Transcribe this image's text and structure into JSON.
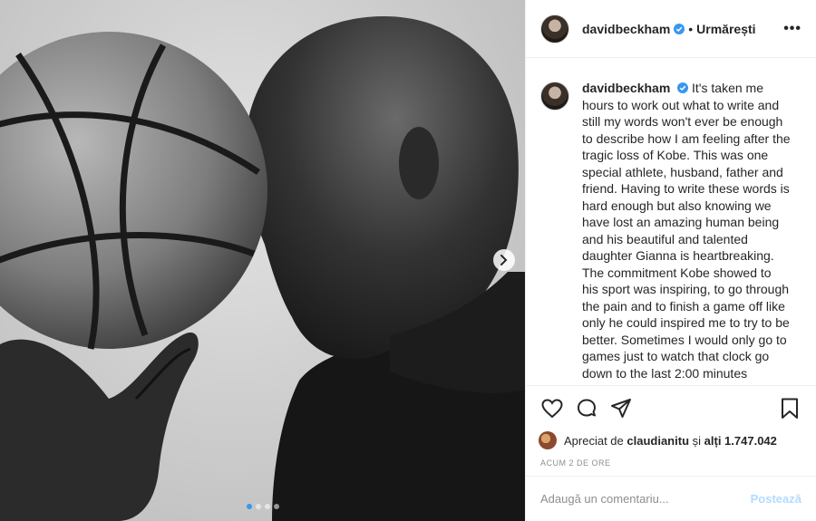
{
  "post": {
    "username": "davidbeckham",
    "follow_label": "Urmărești",
    "separator": "•",
    "more_label": "•••",
    "caption": "It's taken me hours to work out what to write and still my words won't ever be enough to describe how I am feeling after the tragic loss of Kobe. This was one special athlete, husband, father and friend. Having to write these words is hard enough but also knowing we have lost an amazing human being and his beautiful and talented daughter Gianna is heartbreaking. The commitment Kobe showed to his sport was inspiring, to go through the pain and to finish a game off like only he could inspired me to try to be better. Sometimes I would only go to games just to watch that clock go down to the last 2:00 minutes knowing that we were about to",
    "likes": {
      "prefix": "Apreciat de",
      "user": "claudianitu",
      "middle": "și",
      "others": "alți 1.747.042"
    },
    "time": "ACUM 2 DE ORE",
    "comment_placeholder": "Adaugă un comentariu...",
    "post_label": "Postează"
  },
  "carousel": {
    "count": 4,
    "active_index": 0
  },
  "icons": {
    "like": "heart-icon",
    "comment": "comment-icon",
    "share": "share-icon",
    "save": "bookmark-icon",
    "next": "chevron-right-icon",
    "verified": "verified-badge-icon"
  },
  "colors": {
    "verified": "#3897f0",
    "post_disabled": "#b3dbff",
    "muted": "#8e8e8e"
  }
}
